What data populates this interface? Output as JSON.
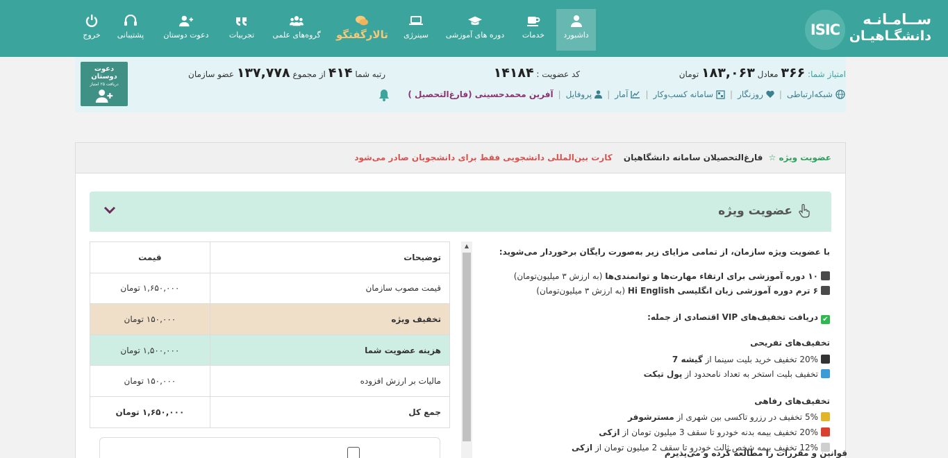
{
  "logo": {
    "mark": "ISIC",
    "line1": "ســامـانـه",
    "line2": "دانشگـاهیـان"
  },
  "nav": [
    {
      "label": "داشبورد",
      "icon": "user-icon"
    },
    {
      "label": "خدمات",
      "icon": "coffee-icon"
    },
    {
      "label": "دوره های آموزشی",
      "icon": "graduation-cap-icon"
    },
    {
      "label": "سینرژی",
      "icon": "laptop-icon"
    },
    {
      "label": "تالارگفتگو",
      "icon": "chat-bubbles-icon"
    },
    {
      "label": "گروه‌های علمی",
      "icon": "users-group-icon"
    },
    {
      "label": "تجربیات",
      "icon": "quote-icon"
    },
    {
      "label": "دعوت دوستان",
      "icon": "user-plus-icon"
    },
    {
      "label": "پشتیبانی",
      "icon": "headset-icon"
    },
    {
      "label": "خروج",
      "icon": "power-icon"
    }
  ],
  "invite": {
    "title": "دعوت دوستان",
    "subtitle": "دریافت ۲۵ امتیاز"
  },
  "stats": {
    "score_label": "امتیاز شما:",
    "score": "۳۶۶",
    "equiv_label": "معادل",
    "equiv_value": "۱۸۳,۰۶۳",
    "currency": "تومان",
    "member_code_label": "کد عضویت :",
    "member_code": "۱۴۱۸۴",
    "rank_label": "رتبه شما",
    "rank": "۴۱۴",
    "of_total_label": "از مجموع",
    "total_members": "۱۳۷,۷۷۸",
    "members_label": "عضو سازمان"
  },
  "links": {
    "network": "شبکه‌ارتباطی",
    "daily": "روزنگار",
    "business": "سامانه کسب‌وکار",
    "stats": "آمار",
    "profile": "پروفایل",
    "user": "آفرین محمدحسینی (فارغ‌التحصیل )"
  },
  "breadcrumb": {
    "special": "عضویت ویژه",
    "graduates": "فارغ‌التحصیلان سامانه دانشگاهیان",
    "notice": "کارت بین‌المللی دانشجویی فقط برای دانشجویان صادر می‌شود"
  },
  "accordion": {
    "title": "عضویت ویژه"
  },
  "benefits": {
    "intro": "با عضویت ویژه سازمان، از تمامی مزایای زیر به‌صورت رایگان برخوردار می‌شوید:",
    "course1_bold": "۱۰ دوره آموزشی برای ارتقاء مهارت‌ها و توانمندی‌ها",
    "course1_rest": "(به ارزش ۳ میلیون‌تومان)",
    "course2_bold": "۶ ترم دوره آموزشی زبان انگلیسی Hi English",
    "course2_rest": "(به ارزش ۳ میلیون‌تومان)",
    "vip": "دریافت تخفیف‌های VIP اقتصادی از جمله:",
    "fun_heading": "تخفیف‌های تفریحی",
    "fun1_text": "20% تخفیف خرید بلیت سینما از",
    "fun1_brand": "گیشه 7",
    "fun2_text": "تخفیف بلیت استخر به تعداد نامحدود از",
    "fun2_brand": "پول تیکت",
    "welfare_heading": "تخفیف‌های رفاهی",
    "w1_text": "5% تخفیف در رزرو تاکسی بین شهری از",
    "w1_brand": "مسترشوفر",
    "w2_text": "20% تخفیف بیمه بدنه خودرو تا سقف 3 میلیون تومان از",
    "w2_brand": "ازکی",
    "w3_text": "12% تخفیف بیمه شخص ثالث خودرو تا سقف 2 میلیون تومان از",
    "w3_brand": "ازکی"
  },
  "price_table": {
    "headers": {
      "desc": "توضیحات",
      "price": "قیمت"
    },
    "rows": [
      {
        "desc": "قیمت مصوب سازمان",
        "price": "۱,۶۵۰,۰۰۰ تومان"
      },
      {
        "desc": "تخفیف ویژه",
        "price": "۱۵۰,۰۰۰ تومان"
      },
      {
        "desc": "هزینه عضویت شما",
        "price": "۱,۵۰۰,۰۰۰ تومان"
      },
      {
        "desc": "مالیات بر ارزش افزوده",
        "price": "۱۵۰,۰۰۰ تومان"
      },
      {
        "desc": "جمع کل",
        "price": "۱,۶۵۰,۰۰۰ تومان"
      }
    ]
  },
  "terms": {
    "label": "قوانین و مقررات را مطالعه کرده و می‌پذیرم"
  },
  "colors": {
    "nav": "#3ba59d",
    "accent_green": "#2ea15e",
    "notice_red": "#d9534f",
    "user_purple": "#8a3470",
    "row_special": "#f0dfc8",
    "row_mine": "#cfeee3"
  }
}
